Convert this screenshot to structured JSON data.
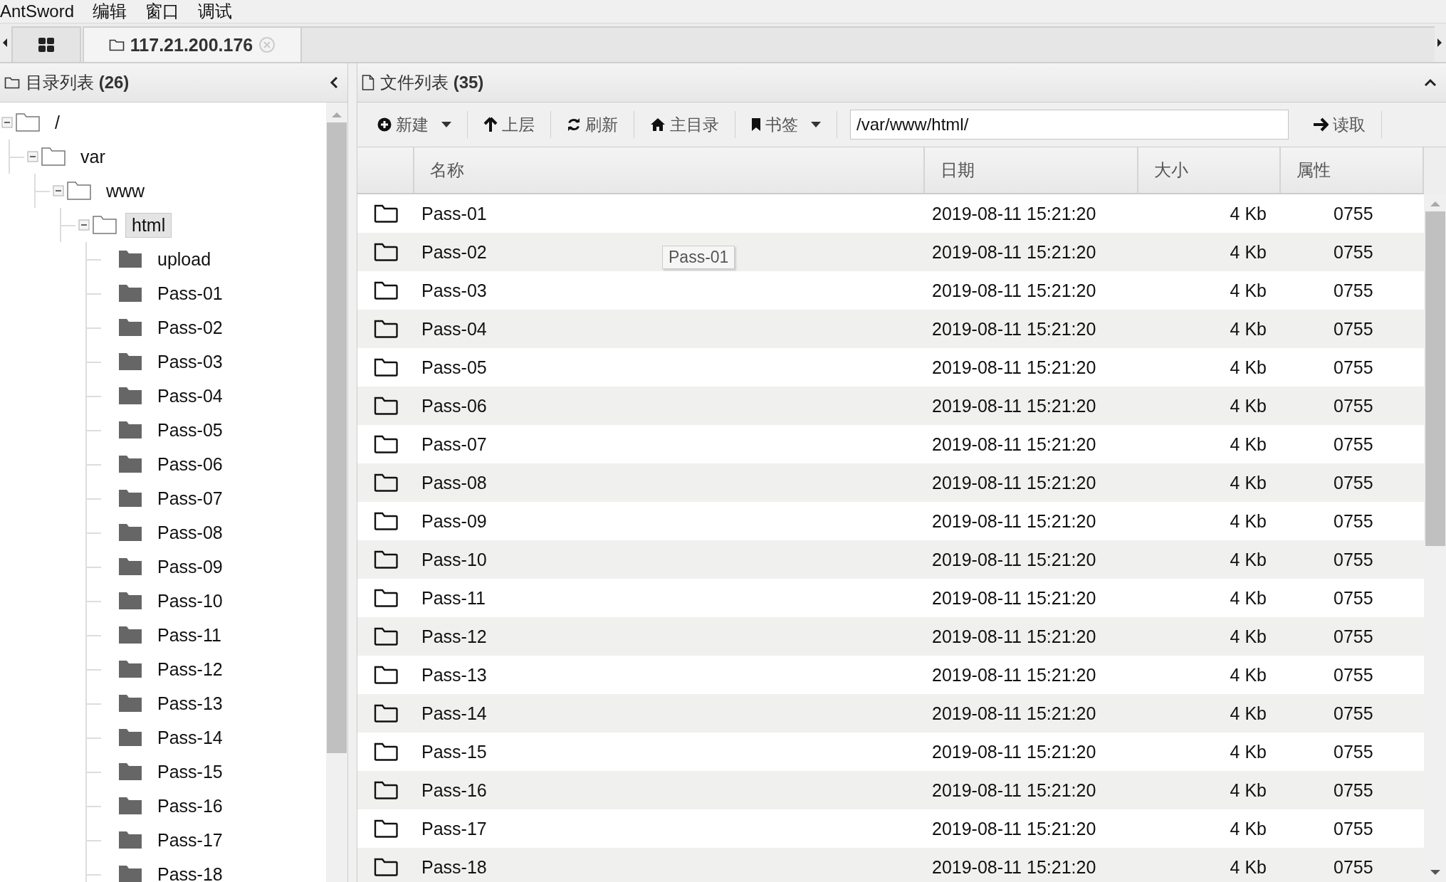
{
  "menu": [
    {
      "label": "AntSword"
    },
    {
      "label": "编辑"
    },
    {
      "label": "窗口"
    },
    {
      "label": "调试"
    }
  ],
  "tabs": [
    {
      "kind": "home",
      "selected": false
    },
    {
      "kind": "host",
      "label": "117.21.200.176",
      "selected": true
    }
  ],
  "dir_panel": {
    "title": "目录列表 **(26)**",
    "tree": [
      {
        "label": "/",
        "expanded": true,
        "selected": false,
        "children": [
          {
            "label": "var",
            "expanded": true,
            "selected": false,
            "children": [
              {
                "label": "www",
                "expanded": true,
                "selected": false,
                "children": [
                  {
                    "label": "html",
                    "expanded": true,
                    "selected": true,
                    "children": [
                      {
                        "label": "upload",
                        "selected": false
                      },
                      {
                        "label": "Pass-01",
                        "selected": false
                      },
                      {
                        "label": "Pass-02",
                        "selected": false
                      },
                      {
                        "label": "Pass-03",
                        "selected": false
                      },
                      {
                        "label": "Pass-04",
                        "selected": false
                      },
                      {
                        "label": "Pass-05",
                        "selected": false
                      },
                      {
                        "label": "Pass-06",
                        "selected": false
                      },
                      {
                        "label": "Pass-07",
                        "selected": false
                      },
                      {
                        "label": "Pass-08",
                        "selected": false
                      },
                      {
                        "label": "Pass-09",
                        "selected": false
                      },
                      {
                        "label": "Pass-10",
                        "selected": false
                      },
                      {
                        "label": "Pass-11",
                        "selected": false
                      },
                      {
                        "label": "Pass-12",
                        "selected": false
                      },
                      {
                        "label": "Pass-13",
                        "selected": false
                      },
                      {
                        "label": "Pass-14",
                        "selected": false
                      },
                      {
                        "label": "Pass-15",
                        "selected": false
                      },
                      {
                        "label": "Pass-16",
                        "selected": false
                      },
                      {
                        "label": "Pass-17",
                        "selected": false
                      },
                      {
                        "label": "Pass-18",
                        "selected": false
                      }
                    ]
                  }
                ]
              }
            ]
          }
        ]
      }
    ]
  },
  "file_panel": {
    "title": "文件列表 **(35)**",
    "toolbar": [
      {
        "kind": "new",
        "label": "新建",
        "dropdown": true
      },
      {
        "kind": "up",
        "label": "上层",
        "dropdown": false
      },
      {
        "kind": "refresh",
        "label": "刷新",
        "dropdown": false
      },
      {
        "kind": "home",
        "label": "主目录",
        "dropdown": false
      },
      {
        "kind": "bookmark",
        "label": "书签",
        "dropdown": true
      }
    ],
    "path": {
      "value": "/var/www/html/"
    },
    "read_button": {
      "label": "读取"
    },
    "columns": [
      "名称",
      "日期",
      "大小",
      "属性"
    ],
    "rows": [
      {
        "name": "Pass-01",
        "date": "2019-08-11 15:21:20",
        "size": "4 Kb",
        "perm": "0755"
      },
      {
        "name": "Pass-02",
        "date": "2019-08-11 15:21:20",
        "size": "4 Kb",
        "perm": "0755"
      },
      {
        "name": "Pass-03",
        "date": "2019-08-11 15:21:20",
        "size": "4 Kb",
        "perm": "0755"
      },
      {
        "name": "Pass-04",
        "date": "2019-08-11 15:21:20",
        "size": "4 Kb",
        "perm": "0755"
      },
      {
        "name": "Pass-05",
        "date": "2019-08-11 15:21:20",
        "size": "4 Kb",
        "perm": "0755"
      },
      {
        "name": "Pass-06",
        "date": "2019-08-11 15:21:20",
        "size": "4 Kb",
        "perm": "0755"
      },
      {
        "name": "Pass-07",
        "date": "2019-08-11 15:21:20",
        "size": "4 Kb",
        "perm": "0755"
      },
      {
        "name": "Pass-08",
        "date": "2019-08-11 15:21:20",
        "size": "4 Kb",
        "perm": "0755"
      },
      {
        "name": "Pass-09",
        "date": "2019-08-11 15:21:20",
        "size": "4 Kb",
        "perm": "0755"
      },
      {
        "name": "Pass-10",
        "date": "2019-08-11 15:21:20",
        "size": "4 Kb",
        "perm": "0755"
      },
      {
        "name": "Pass-11",
        "date": "2019-08-11 15:21:20",
        "size": "4 Kb",
        "perm": "0755"
      },
      {
        "name": "Pass-12",
        "date": "2019-08-11 15:21:20",
        "size": "4 Kb",
        "perm": "0755"
      },
      {
        "name": "Pass-13",
        "date": "2019-08-11 15:21:20",
        "size": "4 Kb",
        "perm": "0755"
      },
      {
        "name": "Pass-14",
        "date": "2019-08-11 15:21:20",
        "size": "4 Kb",
        "perm": "0755"
      },
      {
        "name": "Pass-15",
        "date": "2019-08-11 15:21:20",
        "size": "4 Kb",
        "perm": "0755"
      },
      {
        "name": "Pass-16",
        "date": "2019-08-11 15:21:20",
        "size": "4 Kb",
        "perm": "0755"
      },
      {
        "name": "Pass-17",
        "date": "2019-08-11 15:21:20",
        "size": "4 Kb",
        "perm": "0755"
      },
      {
        "name": "Pass-18",
        "date": "2019-08-11 15:21:20",
        "size": "4 Kb",
        "perm": "0755"
      }
    ],
    "tooltip": "Pass-01"
  }
}
